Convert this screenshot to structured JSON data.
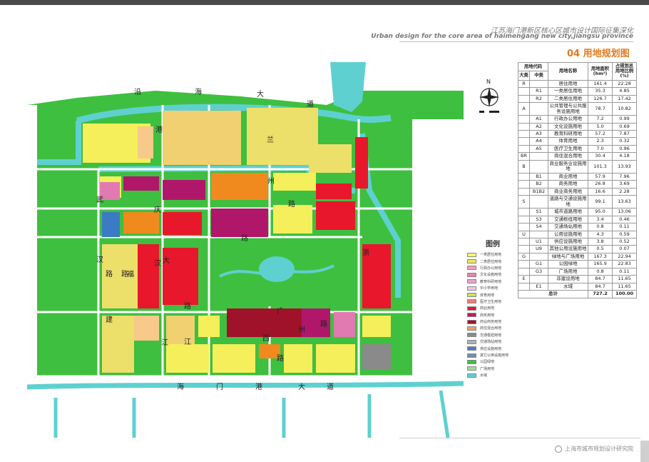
{
  "header": {
    "title_cn": "江苏海门港新区核心区城市设计国际征集深化",
    "title_en": "Urban design for the core area of haimengang new city,jiangsu province"
  },
  "section": {
    "title": "04  用地规划图"
  },
  "map": {
    "road_labels": [
      "沿",
      "海",
      "大",
      "道",
      "港",
      "兰",
      "州",
      "路",
      "武",
      "汉",
      "路",
      "福",
      "建",
      "路",
      "大",
      "庆",
      "路",
      "广",
      "州",
      "路",
      "江",
      "西",
      "路",
      "海",
      "门",
      "港",
      "大",
      "道",
      "汉",
      "江",
      "路",
      "浙"
    ],
    "north_label": "N",
    "colors": {
      "water": "#5fd0d0",
      "park": "#3fbf3f",
      "res_1": "#f4ef5a",
      "res_2": "#ece06a",
      "commercial": "#e8172b",
      "business": "#b0176b",
      "mixed": "#f08a1e",
      "public": "#e07ab0",
      "education": "#3b7bc4",
      "utility": "#8a8a8a"
    }
  },
  "legend": {
    "title": "图例",
    "items": [
      {
        "label": "一类居住用地",
        "color": "#f7f36a"
      },
      {
        "label": "二类居住用地",
        "color": "#ede45a"
      },
      {
        "label": "行政办公用地",
        "color": "#f2a0c0"
      },
      {
        "label": "文化设施用地",
        "color": "#f080a8"
      },
      {
        "label": "教育科研用地",
        "color": "#f0a0d0"
      },
      {
        "label": "中小学用地",
        "color": "#f3c7de"
      },
      {
        "label": "体育用地",
        "color": "#c8e060"
      },
      {
        "label": "医疗卫生用地",
        "color": "#f07c7c"
      },
      {
        "label": "商业用地",
        "color": "#e8172b"
      },
      {
        "label": "商务用地",
        "color": "#c01a5a"
      },
      {
        "label": "商业商务用地",
        "color": "#a0122a"
      },
      {
        "label": "商住混合用地",
        "color": "#f0a060"
      },
      {
        "label": "交通枢纽用地",
        "color": "#8a8a8a"
      },
      {
        "label": "交通场站用地",
        "color": "#b0b0b0"
      },
      {
        "label": "供应设施用地",
        "color": "#4a7cc8"
      },
      {
        "label": "其它公用设施用地",
        "color": "#7090b0"
      },
      {
        "label": "公园绿地",
        "color": "#3fbf3f"
      },
      {
        "label": "广场用地",
        "color": "#9ae09a"
      },
      {
        "label": "水域",
        "color": "#5fd0d0"
      }
    ]
  },
  "table": {
    "header": {
      "code": "用地代码",
      "major": "大类",
      "medium": "中类",
      "name": "用地名称",
      "area": "用地面积(hm²)",
      "ratio": "占规划总用地比例(%)"
    },
    "rows": [
      {
        "major": "R",
        "medium": "",
        "name": "居住用地",
        "area": "161.4",
        "ratio": "22.28"
      },
      {
        "major": "",
        "medium": "R1",
        "name": "一类居住用地",
        "area": "35.3",
        "ratio": "4.85"
      },
      {
        "major": "",
        "medium": "R2",
        "name": "二类居住用地",
        "area": "126.7",
        "ratio": "17.42"
      },
      {
        "major": "A",
        "medium": "",
        "name": "公共管理与公共服务设施用地",
        "area": "78.7",
        "ratio": "10.82"
      },
      {
        "major": "",
        "medium": "A1",
        "name": "行政办公用地",
        "area": "7.2",
        "ratio": "0.99"
      },
      {
        "major": "",
        "medium": "A2",
        "name": "文化设施用地",
        "area": "5.0",
        "ratio": "0.69"
      },
      {
        "major": "",
        "medium": "A3",
        "name": "教育科研用地",
        "area": "57.2",
        "ratio": "7.87"
      },
      {
        "major": "",
        "medium": "A4",
        "name": "体育用地",
        "area": "2.3",
        "ratio": "0.32"
      },
      {
        "major": "",
        "medium": "A5",
        "name": "医疗卫生用地",
        "area": "7.0",
        "ratio": "0.96"
      },
      {
        "major": "BR",
        "medium": "",
        "name": "商住混合用地",
        "area": "30.4",
        "ratio": "4.18"
      },
      {
        "major": "B",
        "medium": "",
        "name": "商业服务业设施用地",
        "area": "101.3",
        "ratio": "13.93"
      },
      {
        "major": "",
        "medium": "B1",
        "name": "商业用地",
        "area": "57.9",
        "ratio": "7.96"
      },
      {
        "major": "",
        "medium": "B2",
        "name": "商务用地",
        "area": "26.8",
        "ratio": "3.69"
      },
      {
        "major": "",
        "medium": "B1B2",
        "name": "商业商务用地",
        "area": "16.6",
        "ratio": "2.28"
      },
      {
        "major": "S",
        "medium": "",
        "name": "道路与交通设施用地",
        "area": "99.1",
        "ratio": "13.63"
      },
      {
        "major": "",
        "medium": "S1",
        "name": "城市道路用地",
        "area": "95.0",
        "ratio": "13.06"
      },
      {
        "major": "",
        "medium": "S3",
        "name": "交通枢纽用地",
        "area": "3.4",
        "ratio": "0.46"
      },
      {
        "major": "",
        "medium": "S4",
        "name": "交通场站用地",
        "area": "0.8",
        "ratio": "0.11"
      },
      {
        "major": "U",
        "medium": "",
        "name": "公用设施用地",
        "area": "4.3",
        "ratio": "0.59"
      },
      {
        "major": "",
        "medium": "U1",
        "name": "供应设施用地",
        "area": "3.8",
        "ratio": "0.52"
      },
      {
        "major": "",
        "medium": "U9",
        "name": "其他公用设施用地",
        "area": "0.5",
        "ratio": "0.07"
      },
      {
        "major": "G",
        "medium": "",
        "name": "绿地与广场用地",
        "area": "167.3",
        "ratio": "22.94"
      },
      {
        "major": "",
        "medium": "G1",
        "name": "公园绿地",
        "area": "165.9",
        "ratio": "22.83"
      },
      {
        "major": "",
        "medium": "G3",
        "name": "广场用地",
        "area": "0.8",
        "ratio": "0.11"
      },
      {
        "major": "E",
        "medium": "",
        "name": "非建设用地",
        "area": "84.7",
        "ratio": "11.65"
      },
      {
        "major": "",
        "medium": "E1",
        "name": "水域",
        "area": "84.7",
        "ratio": "11.65"
      }
    ],
    "total": {
      "label": "总计",
      "area": "727.2",
      "ratio": "100.00"
    }
  },
  "footer": {
    "org": "上海市城市规划设计研究院"
  }
}
